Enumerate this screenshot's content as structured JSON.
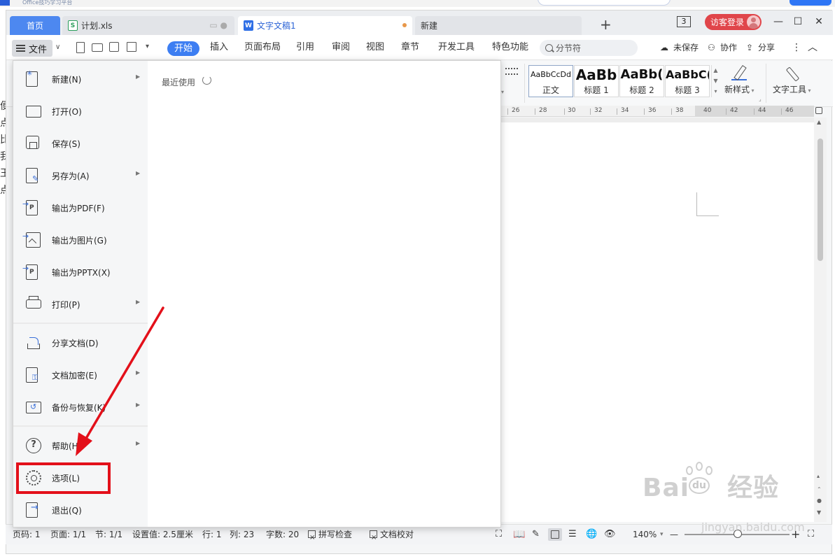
{
  "background": {
    "top_caption": "Office技巧学习平台",
    "left_strip": [
      "便",
      "点",
      "比",
      "我",
      "王",
      "点"
    ]
  },
  "tabs": [
    {
      "label": "首页",
      "extra": ""
    },
    {
      "label": "计划.xls",
      "icon": "spreadsheet-icon",
      "extra": "▭ ●"
    },
    {
      "label": "文字文稿1",
      "icon": "document-icon"
    },
    {
      "label": "新建"
    }
  ],
  "titlebar": {
    "new_tab": "+",
    "window_count": "3",
    "login_label": "访客登录",
    "minimize": "—",
    "maximize": "☐",
    "close": "✕"
  },
  "menubar": {
    "file_label": "文件",
    "tabs": [
      "开始",
      "插入",
      "页面布局",
      "引用",
      "审阅",
      "视图",
      "章节",
      "开发工具",
      "特色功能"
    ],
    "active_tab": "开始",
    "search_label": "分节符",
    "unsaved": "未保存",
    "collab": "协作",
    "share": "分享",
    "more": "⋮",
    "collapse": "︿"
  },
  "ribbon": {
    "styles": [
      {
        "sample": "AaBbCcDd",
        "label": "正文"
      },
      {
        "sample": "AaBb",
        "label": "标题 1"
      },
      {
        "sample": "AaBb(",
        "label": "标题 2"
      },
      {
        "sample": "AaBbC(",
        "label": "标题 3"
      }
    ],
    "new_style": "新样式",
    "text_tools": "文字工具"
  },
  "ruler": {
    "ticks": [
      "26",
      "28",
      "30",
      "32",
      "34",
      "36",
      "38",
      "40",
      "42",
      "44",
      "46"
    ]
  },
  "file_menu": {
    "items": [
      {
        "label": "新建(N)",
        "icon": "new-document-icon",
        "submenu": true
      },
      {
        "label": "打开(O)",
        "icon": "open-folder-icon",
        "submenu": false
      },
      {
        "label": "保存(S)",
        "icon": "save-icon",
        "submenu": false
      },
      {
        "label": "另存为(A)",
        "icon": "save-as-icon",
        "submenu": true
      },
      {
        "label": "输出为PDF(F)",
        "icon": "export-pdf-icon",
        "submenu": false
      },
      {
        "label": "输出为图片(G)",
        "icon": "export-image-icon",
        "submenu": false
      },
      {
        "label": "输出为PPTX(X)",
        "icon": "export-pptx-icon",
        "submenu": false
      },
      {
        "label": "打印(P)",
        "icon": "print-icon",
        "submenu": true
      },
      {
        "label": "分享文档(D)",
        "icon": "share-document-icon",
        "submenu": false
      },
      {
        "label": "文档加密(E)",
        "icon": "encrypt-document-icon",
        "submenu": true
      },
      {
        "label": "备份与恢复(K)",
        "icon": "backup-restore-icon",
        "submenu": true
      },
      {
        "label": "帮助(H)",
        "icon": "help-icon",
        "submenu": true
      },
      {
        "label": "选项(L)",
        "icon": "gear-icon",
        "submenu": false
      },
      {
        "label": "退出(Q)",
        "icon": "exit-icon",
        "submenu": false
      }
    ],
    "recent_title": "最近使用",
    "arrow_glyph": "▶"
  },
  "statusbar": {
    "page_number": "页码: 1",
    "pages": "页面: 1/1",
    "section": "节: 1/1",
    "setting": "设置值: 2.5厘米",
    "row": "行: 1",
    "col": "列: 23",
    "word_count": "字数: 20",
    "spell_check": "拼写检查",
    "doc_proof": "文档校对",
    "zoom": "140%",
    "zoom_out": "—",
    "zoom_in": "+"
  },
  "watermark": {
    "brand": "Bai",
    "brand_tail": "经验",
    "paw_text": "du",
    "url": "jingyan.baidu.com"
  },
  "colors": {
    "accent": "#3d7ef2",
    "login": "#e0454a",
    "annotation": "#e3101a"
  }
}
